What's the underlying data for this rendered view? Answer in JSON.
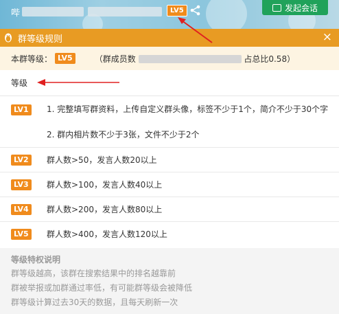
{
  "topbar": {
    "group_name_prefix": "哔",
    "level_badge": "LV5",
    "start_chat_label": "发起会话"
  },
  "dialog": {
    "title": "群等级规则",
    "close": "×"
  },
  "info": {
    "label": "本群等级：",
    "level_badge": "LV5",
    "detail_prefix": "（群成员数",
    "detail_suffix": "占总比0.58）"
  },
  "level_header": "等级",
  "levels": [
    {
      "badge": "LV1",
      "lines": [
        "1. 完整填写群资料，上传自定义群头像，标签不少于1个，简介不少于30个字",
        "2. 群内相片数不少于3张，文件不少于2个"
      ]
    },
    {
      "badge": "LV2",
      "lines": [
        "群人数>50，发言人数20以上"
      ]
    },
    {
      "badge": "LV3",
      "lines": [
        "群人数>100，发言人数40以上"
      ]
    },
    {
      "badge": "LV4",
      "lines": [
        "群人数>200，发言人数80以上"
      ]
    },
    {
      "badge": "LV5",
      "lines": [
        "群人数>400，发言人数120以上"
      ]
    }
  ],
  "privileges": {
    "heading": "等级特权说明",
    "items": [
      "群等级越高，该群在搜索结果中的排名越靠前",
      "群被举报或加群通过率低，有可能群等级会被降低",
      "群等级计算过去30天的数据，且每天刷新一次"
    ]
  },
  "colors": {
    "accent_orange": "#e89b23",
    "badge_orange": "#f08b1c",
    "chat_green": "#20a25a",
    "arrow_red": "#e02020"
  }
}
